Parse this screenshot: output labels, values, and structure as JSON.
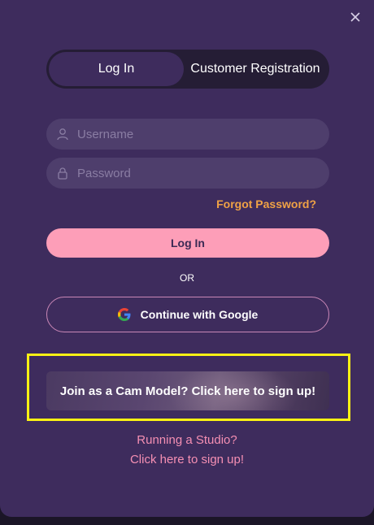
{
  "tabs": {
    "login": "Log In",
    "register": "Customer Registration"
  },
  "form": {
    "username_placeholder": "Username",
    "password_placeholder": "Password",
    "forgot_label": "Forgot Password?",
    "login_label": "Log In",
    "or_label": "OR",
    "google_label": "Continue with Google"
  },
  "banner": {
    "model_label": "Join as a Cam Model? Click here to sign up!"
  },
  "studio": {
    "line1": "Running a Studio?",
    "line2": "Click here to sign up!"
  },
  "icons": {
    "close": "close-icon",
    "user": "user-icon",
    "lock": "lock-icon",
    "google": "google-logo-icon"
  },
  "colors": {
    "modal_bg": "#3e2c5d",
    "accent_pink": "#fd9eb8",
    "forgot_orange": "#f0a245",
    "highlight_yellow": "#fbf114"
  }
}
